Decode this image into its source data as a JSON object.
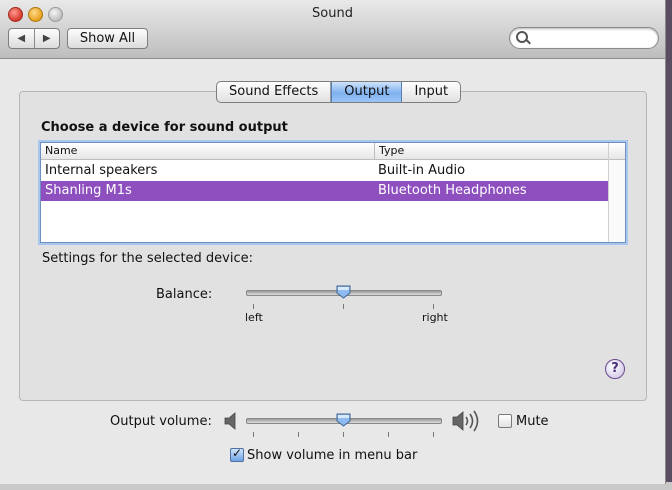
{
  "window": {
    "title": "Sound"
  },
  "toolbar": {
    "back_label": "◀",
    "forward_label": "▶",
    "show_all_label": "Show All",
    "search_placeholder": ""
  },
  "tabs": [
    {
      "label": "Sound Effects",
      "selected": false
    },
    {
      "label": "Output",
      "selected": true
    },
    {
      "label": "Input",
      "selected": false
    }
  ],
  "output": {
    "heading": "Choose a device for sound output",
    "columns": [
      "Name",
      "Type"
    ],
    "devices": [
      {
        "name": "Internal speakers",
        "type": "Built-in Audio",
        "selected": false
      },
      {
        "name": "Shanling M1s",
        "type": "Bluetooth Headphones",
        "selected": true
      }
    ],
    "settings_label": "Settings for the selected device:",
    "balance": {
      "label": "Balance:",
      "left_label": "left",
      "right_label": "right",
      "value": 0.5
    },
    "help_label": "?"
  },
  "volume": {
    "label": "Output volume:",
    "value": 0.5,
    "mute_label": "Mute",
    "mute_checked": false,
    "show_in_menubar_label": "Show volume in menu bar",
    "show_in_menubar_checked": true
  },
  "colors": {
    "selection": "#8e4fbf",
    "accent_blue": "#7fb1ef",
    "desktop": "#4a3f52"
  }
}
